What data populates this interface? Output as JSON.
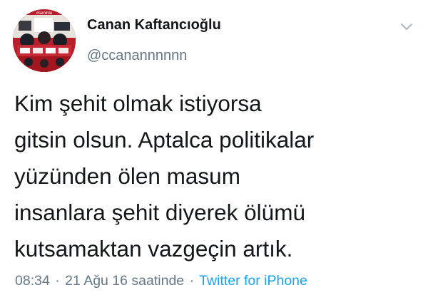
{
  "user": {
    "display_name": "Canan Kaftancıoğlu",
    "handle": "@ccanannnnnn",
    "avatar_badge_text": "#seninle"
  },
  "tweet": {
    "lines": [
      "Kim şehit olmak istiyorsa",
      "gitsin olsun. Aptalca politikalar",
      "yüzünden ölen masum",
      "insanlara şehit diyerek ölümü",
      "kutsamaktan vazgeçin artık."
    ]
  },
  "meta": {
    "time": "08:34",
    "separator": "·",
    "date": "21 Ağu 16 saatinde",
    "source": "Twitter for iPhone"
  },
  "icons": {
    "caret": "chevron-down-icon"
  },
  "colors": {
    "text": "#14171a",
    "secondary": "#657786",
    "link": "#1da1f2",
    "avatar_bg": "#b81e2a"
  }
}
